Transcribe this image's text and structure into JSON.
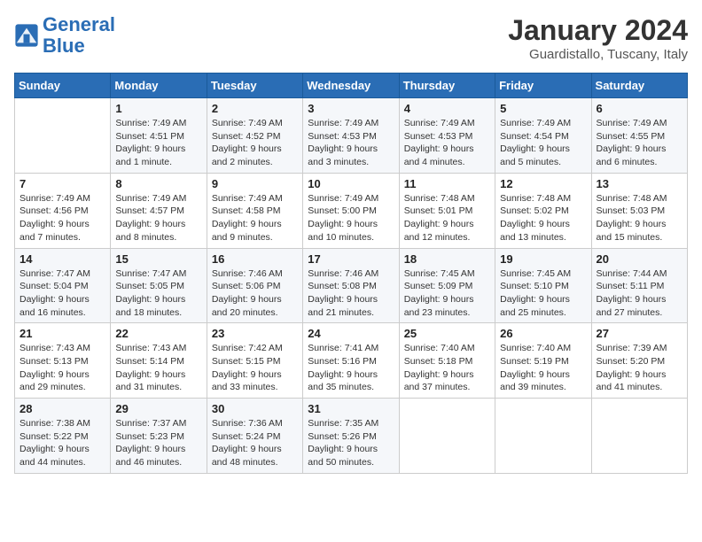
{
  "header": {
    "logo_line1": "General",
    "logo_line2": "Blue",
    "month": "January 2024",
    "location": "Guardistallo, Tuscany, Italy"
  },
  "days_of_week": [
    "Sunday",
    "Monday",
    "Tuesday",
    "Wednesday",
    "Thursday",
    "Friday",
    "Saturday"
  ],
  "weeks": [
    [
      {
        "num": "",
        "detail": ""
      },
      {
        "num": "1",
        "detail": "Sunrise: 7:49 AM\nSunset: 4:51 PM\nDaylight: 9 hours\nand 1 minute."
      },
      {
        "num": "2",
        "detail": "Sunrise: 7:49 AM\nSunset: 4:52 PM\nDaylight: 9 hours\nand 2 minutes."
      },
      {
        "num": "3",
        "detail": "Sunrise: 7:49 AM\nSunset: 4:53 PM\nDaylight: 9 hours\nand 3 minutes."
      },
      {
        "num": "4",
        "detail": "Sunrise: 7:49 AM\nSunset: 4:53 PM\nDaylight: 9 hours\nand 4 minutes."
      },
      {
        "num": "5",
        "detail": "Sunrise: 7:49 AM\nSunset: 4:54 PM\nDaylight: 9 hours\nand 5 minutes."
      },
      {
        "num": "6",
        "detail": "Sunrise: 7:49 AM\nSunset: 4:55 PM\nDaylight: 9 hours\nand 6 minutes."
      }
    ],
    [
      {
        "num": "7",
        "detail": "Sunrise: 7:49 AM\nSunset: 4:56 PM\nDaylight: 9 hours\nand 7 minutes."
      },
      {
        "num": "8",
        "detail": "Sunrise: 7:49 AM\nSunset: 4:57 PM\nDaylight: 9 hours\nand 8 minutes."
      },
      {
        "num": "9",
        "detail": "Sunrise: 7:49 AM\nSunset: 4:58 PM\nDaylight: 9 hours\nand 9 minutes."
      },
      {
        "num": "10",
        "detail": "Sunrise: 7:49 AM\nSunset: 5:00 PM\nDaylight: 9 hours\nand 10 minutes."
      },
      {
        "num": "11",
        "detail": "Sunrise: 7:48 AM\nSunset: 5:01 PM\nDaylight: 9 hours\nand 12 minutes."
      },
      {
        "num": "12",
        "detail": "Sunrise: 7:48 AM\nSunset: 5:02 PM\nDaylight: 9 hours\nand 13 minutes."
      },
      {
        "num": "13",
        "detail": "Sunrise: 7:48 AM\nSunset: 5:03 PM\nDaylight: 9 hours\nand 15 minutes."
      }
    ],
    [
      {
        "num": "14",
        "detail": "Sunrise: 7:47 AM\nSunset: 5:04 PM\nDaylight: 9 hours\nand 16 minutes."
      },
      {
        "num": "15",
        "detail": "Sunrise: 7:47 AM\nSunset: 5:05 PM\nDaylight: 9 hours\nand 18 minutes."
      },
      {
        "num": "16",
        "detail": "Sunrise: 7:46 AM\nSunset: 5:06 PM\nDaylight: 9 hours\nand 20 minutes."
      },
      {
        "num": "17",
        "detail": "Sunrise: 7:46 AM\nSunset: 5:08 PM\nDaylight: 9 hours\nand 21 minutes."
      },
      {
        "num": "18",
        "detail": "Sunrise: 7:45 AM\nSunset: 5:09 PM\nDaylight: 9 hours\nand 23 minutes."
      },
      {
        "num": "19",
        "detail": "Sunrise: 7:45 AM\nSunset: 5:10 PM\nDaylight: 9 hours\nand 25 minutes."
      },
      {
        "num": "20",
        "detail": "Sunrise: 7:44 AM\nSunset: 5:11 PM\nDaylight: 9 hours\nand 27 minutes."
      }
    ],
    [
      {
        "num": "21",
        "detail": "Sunrise: 7:43 AM\nSunset: 5:13 PM\nDaylight: 9 hours\nand 29 minutes."
      },
      {
        "num": "22",
        "detail": "Sunrise: 7:43 AM\nSunset: 5:14 PM\nDaylight: 9 hours\nand 31 minutes."
      },
      {
        "num": "23",
        "detail": "Sunrise: 7:42 AM\nSunset: 5:15 PM\nDaylight: 9 hours\nand 33 minutes."
      },
      {
        "num": "24",
        "detail": "Sunrise: 7:41 AM\nSunset: 5:16 PM\nDaylight: 9 hours\nand 35 minutes."
      },
      {
        "num": "25",
        "detail": "Sunrise: 7:40 AM\nSunset: 5:18 PM\nDaylight: 9 hours\nand 37 minutes."
      },
      {
        "num": "26",
        "detail": "Sunrise: 7:40 AM\nSunset: 5:19 PM\nDaylight: 9 hours\nand 39 minutes."
      },
      {
        "num": "27",
        "detail": "Sunrise: 7:39 AM\nSunset: 5:20 PM\nDaylight: 9 hours\nand 41 minutes."
      }
    ],
    [
      {
        "num": "28",
        "detail": "Sunrise: 7:38 AM\nSunset: 5:22 PM\nDaylight: 9 hours\nand 44 minutes."
      },
      {
        "num": "29",
        "detail": "Sunrise: 7:37 AM\nSunset: 5:23 PM\nDaylight: 9 hours\nand 46 minutes."
      },
      {
        "num": "30",
        "detail": "Sunrise: 7:36 AM\nSunset: 5:24 PM\nDaylight: 9 hours\nand 48 minutes."
      },
      {
        "num": "31",
        "detail": "Sunrise: 7:35 AM\nSunset: 5:26 PM\nDaylight: 9 hours\nand 50 minutes."
      },
      {
        "num": "",
        "detail": ""
      },
      {
        "num": "",
        "detail": ""
      },
      {
        "num": "",
        "detail": ""
      }
    ]
  ]
}
